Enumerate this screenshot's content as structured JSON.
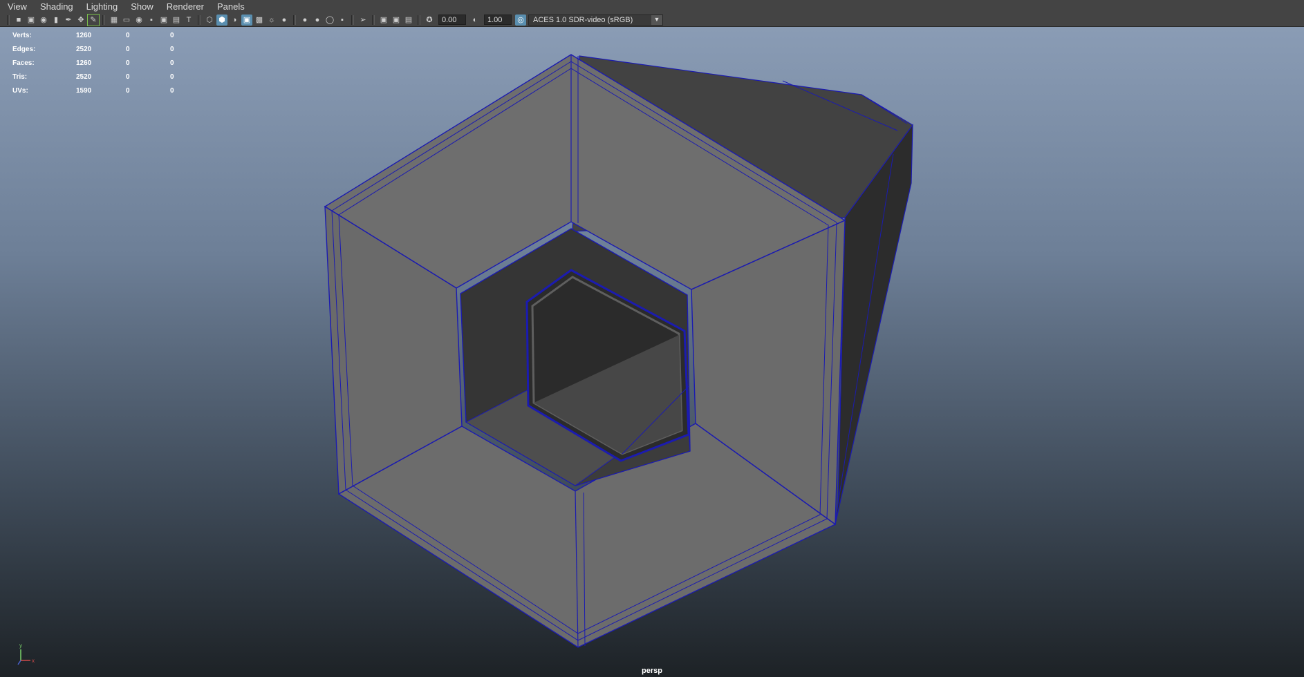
{
  "menu": [
    "View",
    "Shading",
    "Lighting",
    "Show",
    "Renderer",
    "Panels"
  ],
  "toolbar": {
    "exposure": "0.00",
    "gamma": "1.00",
    "color_space": "ACES 1.0 SDR-video (sRGB)"
  },
  "hud": [
    {
      "label": "Verts:",
      "v1": "1260",
      "v2": "0",
      "v3": "0"
    },
    {
      "label": "Edges:",
      "v1": "2520",
      "v2": "0",
      "v3": "0"
    },
    {
      "label": "Faces:",
      "v1": "1260",
      "v2": "0",
      "v3": "0"
    },
    {
      "label": "Tris:",
      "v1": "2520",
      "v2": "0",
      "v3": "0"
    },
    {
      "label": "UVs:",
      "v1": "1590",
      "v2": "0",
      "v3": "0"
    }
  ],
  "camera": "persp",
  "axis": {
    "y": "y",
    "x": "x"
  },
  "colors": {
    "wire": "#1b1bb0",
    "face_light": "#6b6b6b",
    "face_dark": "#3f3f3f",
    "face_darker": "#262626"
  }
}
